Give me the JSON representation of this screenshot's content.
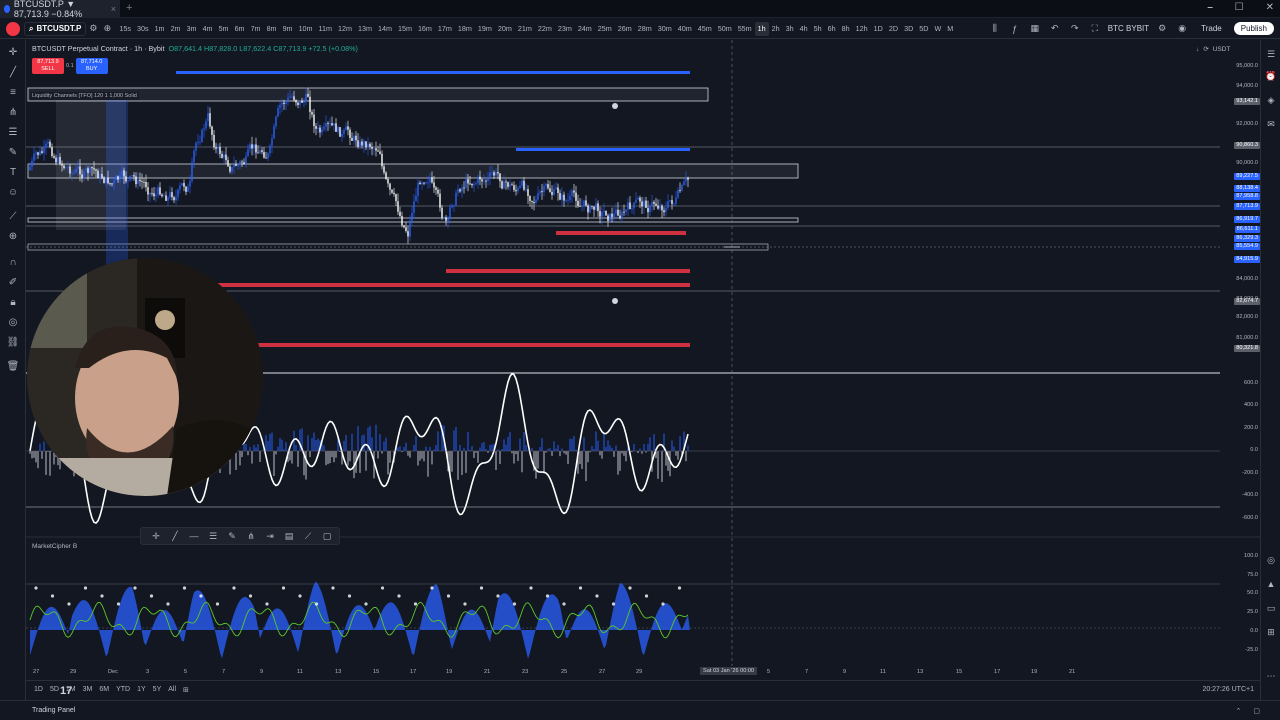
{
  "browser": {
    "tab_title": "BTCUSDT.P ▼ 87,713.9 −0.84%",
    "tab_close": "×",
    "new_tab": "+",
    "window_controls": [
      "⎯",
      "☐",
      "✕"
    ]
  },
  "toolbar": {
    "symbol": "BTCUSDT.P",
    "intervals": [
      "15s",
      "30s",
      "1m",
      "2m",
      "3m",
      "4m",
      "5m",
      "6m",
      "7m",
      "8m",
      "9m",
      "10m",
      "11m",
      "12m",
      "13m",
      "14m",
      "15m",
      "16m",
      "17m",
      "18m",
      "19m",
      "20m",
      "21m",
      "22m",
      "23m",
      "24m",
      "25m",
      "26m",
      "28m",
      "30m",
      "40m",
      "45m",
      "50m",
      "55m",
      "1h",
      "2h",
      "3h",
      "4h",
      "5h",
      "6h",
      "8h",
      "12h",
      "1D",
      "2D",
      "3D",
      "5D",
      "W",
      "M"
    ],
    "active_interval": "1h",
    "exchange_label": "BTC BYBIT",
    "trade_label": "Trade",
    "publish_label": "Publish"
  },
  "legend": {
    "title": "BTCUSDT Perpetual Contract · 1h · Bybit",
    "ohlc": "O87,641.4 H87,828.0 L87,622.4 C87,713.9 +72.5 (+0.08%)",
    "sell_price": "87,713.9",
    "sell_label": "SELL",
    "buy_price": "87,714.0",
    "buy_label": "BUY",
    "spread": "0.1",
    "indicator": "Liquidity Channels [TFO] 120 1 1,000 Solid",
    "market_cipher": "MarketCipher B"
  },
  "axis": {
    "currency": "USDT",
    "price_ticks": [
      "95,000.0",
      "94,000.0",
      "92,000.0",
      "90,000.0",
      "84,000.0",
      "83,000.0",
      "82,000.0",
      "81,000.0"
    ],
    "price_labels": [
      {
        "text": "93,142.1",
        "color": "#5d606b"
      },
      {
        "text": "90,860.3",
        "color": "#5d606b"
      },
      {
        "text": "89,227.5",
        "color": "#2962ff"
      },
      {
        "text": "88,138.4",
        "color": "#2962ff"
      },
      {
        "text": "87,958.8",
        "color": "#2962ff"
      },
      {
        "text": "87,713.9",
        "color": "#2962ff"
      },
      {
        "text": "86,919.7",
        "color": "#2962ff"
      },
      {
        "text": "86,611.1",
        "color": "#2962ff"
      },
      {
        "text": "86,329.3",
        "color": "#2962ff"
      },
      {
        "text": "85,554.9",
        "color": "#2962ff"
      },
      {
        "text": "84,915.9",
        "color": "#2962ff"
      },
      {
        "text": "82,674.7",
        "color": "#5d606b"
      },
      {
        "text": "80,321.8",
        "color": "#5d606b"
      }
    ],
    "osc_ticks": [
      "600.0",
      "400.0",
      "200.0",
      "0.0",
      "-200.0",
      "-400.0",
      "-600.0"
    ],
    "mc_ticks": [
      "100.0",
      "75.0",
      "50.0",
      "25.0",
      "0.0",
      "-25.0"
    ],
    "time_ticks": [
      "27",
      "29",
      "Dec",
      "3",
      "5",
      "7",
      "9",
      "11",
      "13",
      "15",
      "17",
      "19",
      "21",
      "23",
      "25",
      "27",
      "29",
      "2026",
      "5",
      "7",
      "9",
      "11",
      "13",
      "15",
      "17",
      "19",
      "21"
    ],
    "cursor_time": "Sat 03 Jan '26  00:00"
  },
  "rangebar": {
    "ranges": [
      "1D",
      "5D",
      "1M",
      "3M",
      "6M",
      "YTD",
      "1Y",
      "5Y",
      "All"
    ],
    "clock": "20:27:26 UTC+1"
  },
  "bottom": {
    "trading_panel": "Trading Panel",
    "logo": "17"
  },
  "colors": {
    "background": "#131722",
    "up": "#2962ff",
    "down": "#f23645",
    "osc_line": "#ffffff",
    "mc_green": "#5ac82a"
  }
}
